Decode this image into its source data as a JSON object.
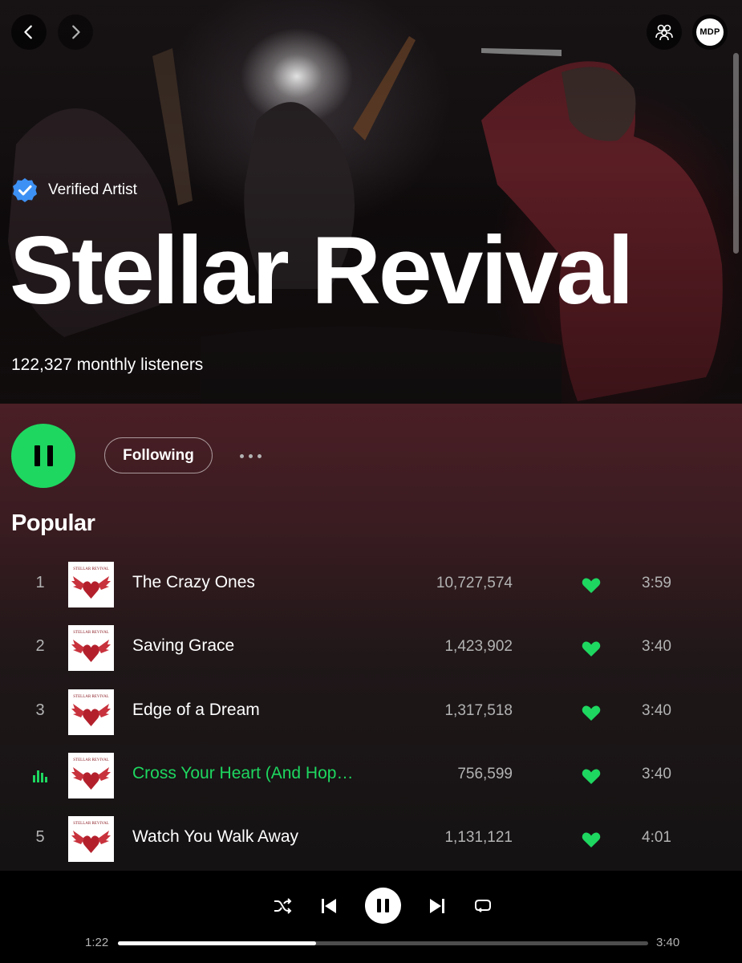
{
  "header": {
    "back_icon": "chevron-left-icon",
    "forward_icon": "chevron-right-icon",
    "friends_icon": "friend-activity-icon",
    "avatar_initials": "MDP"
  },
  "artist": {
    "verified_label": "Verified Artist",
    "name": "Stellar Revival",
    "monthly_listeners": "122,327 monthly listeners"
  },
  "actions": {
    "play_state_icon": "pause-icon",
    "follow_label": "Following",
    "more_icon": "more-options-icon"
  },
  "popular": {
    "title": "Popular",
    "album_art_text": "STELLAR REVIVAL",
    "tracks": [
      {
        "rank": "1",
        "title": "The Crazy Ones",
        "plays": "10,727,574",
        "liked": true,
        "duration": "3:59",
        "playing": false
      },
      {
        "rank": "2",
        "title": "Saving Grace",
        "plays": "1,423,902",
        "liked": true,
        "duration": "3:40",
        "playing": false
      },
      {
        "rank": "3",
        "title": "Edge of a Dream",
        "plays": "1,317,518",
        "liked": true,
        "duration": "3:40",
        "playing": false
      },
      {
        "rank": "",
        "title": "Cross Your Heart (And Hop…",
        "plays": "756,599",
        "liked": true,
        "duration": "3:40",
        "playing": true
      },
      {
        "rank": "5",
        "title": "Watch You Walk Away",
        "plays": "1,131,121",
        "liked": true,
        "duration": "4:01",
        "playing": false
      }
    ]
  },
  "player": {
    "current_time": "1:22",
    "total_time": "3:40",
    "progress_fraction": 0.373,
    "shuffle_icon": "shuffle-icon",
    "previous_icon": "skip-previous-icon",
    "play_state_icon": "pause-icon",
    "next_icon": "skip-next-icon",
    "repeat_icon": "repeat-icon"
  },
  "colors": {
    "accent": "#1ed760",
    "header_tint": "#4a1f25",
    "background": "#121212"
  }
}
